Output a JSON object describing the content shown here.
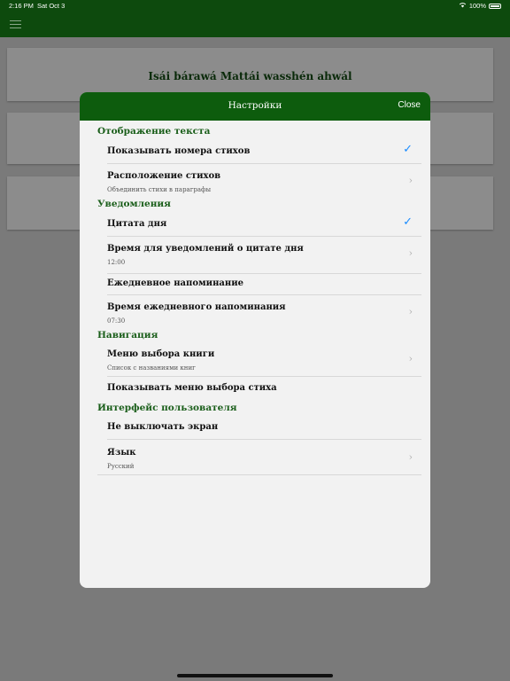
{
  "status": {
    "time": "2:16 PM",
    "date": "Sat Oct 3",
    "battery": "100%"
  },
  "background": {
    "card_title": "Isái bárawá Mattái wasshén ahwál"
  },
  "modal": {
    "title": "Настройки",
    "close_label": "Close",
    "sections": {
      "text_display": "Отображение текста",
      "notifications": "Уведомления",
      "navigation": "Навигация",
      "user_interface": "Интерфейс пользователя"
    },
    "rows": {
      "show_verse_numbers": {
        "label": "Показывать номера стихов",
        "checked": true
      },
      "verse_layout": {
        "label": "Расположение стихов",
        "sub": "Объединить стихи в параграфы"
      },
      "verse_of_day": {
        "label": "Цитата дня",
        "checked": true
      },
      "verse_notify_time": {
        "label": "Время для уведомлений о цитате дня",
        "sub": "12:00"
      },
      "daily_reminder": {
        "label": "Ежедневное напоминание"
      },
      "daily_reminder_time": {
        "label": "Время ежедневного напоминания",
        "sub": "07:30"
      },
      "book_menu": {
        "label": "Меню выбора книги",
        "sub": "Список с названиями книг"
      },
      "show_verse_menu": {
        "label": "Показывать меню выбора стиха"
      },
      "keep_screen_on": {
        "label": "Не выключать экран"
      },
      "language": {
        "label": "Язык",
        "sub": "Русский"
      }
    }
  },
  "icons": {
    "check": "✓",
    "chevron": "›"
  },
  "colors": {
    "header_green": "#0d4a0d",
    "modal_header_green": "#0d5c0d",
    "section_green": "#1a5e1a",
    "check_blue": "#1a8cff"
  }
}
